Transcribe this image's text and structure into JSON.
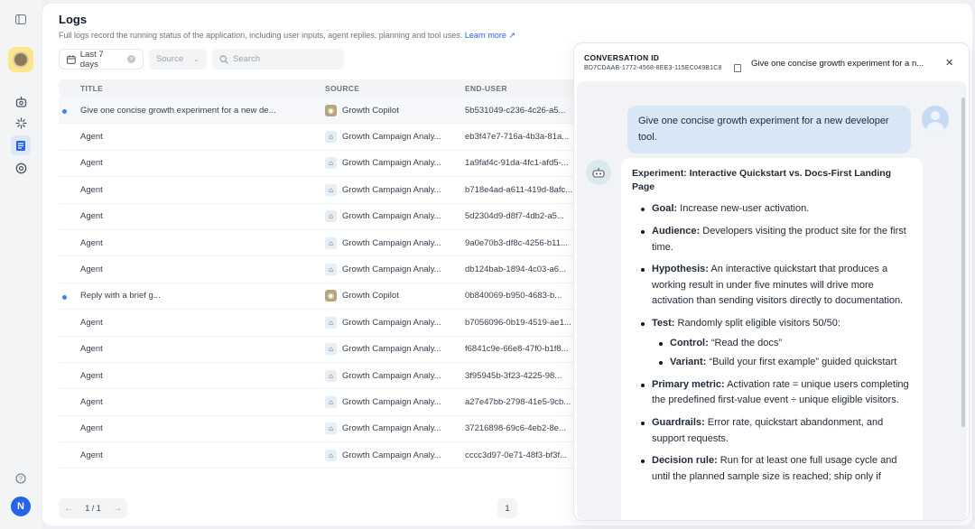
{
  "rail": {
    "icons": [
      "sidebar-toggle-icon",
      "app-avatar",
      "robot-icon",
      "sparkle-icon",
      "logs-icon",
      "gauge-icon",
      "help-icon"
    ],
    "user_initial": "N"
  },
  "page": {
    "title": "Logs",
    "description": "Full logs record the running status of the application, including user inputs, agent replies, planning and tool uses.",
    "learn_more": "Learn more"
  },
  "filters": {
    "date_label": "Last 7 days",
    "source_placeholder": "Source",
    "search_placeholder": "Search"
  },
  "table": {
    "columns": [
      "TITLE",
      "SOURCE",
      "END-USER"
    ],
    "rows": [
      {
        "title": "Give one concise growth experiment for a new de...",
        "source": "Growth Copilot",
        "end_user": "5b531049-c236-4c26-a5...",
        "unread": true,
        "kind": "copilot",
        "selected": true
      },
      {
        "title": "Agent",
        "source": "Growth Campaign Analy...",
        "end_user": "eb3f47e7-716a-4b3a-81a...",
        "unread": false,
        "kind": "bot",
        "selected": false
      },
      {
        "title": "Agent",
        "source": "Growth Campaign Analy...",
        "end_user": "1a9faf4c-91da-4fc1-afd5-...",
        "unread": false,
        "kind": "bot",
        "selected": false
      },
      {
        "title": "Agent",
        "source": "Growth Campaign Analy...",
        "end_user": "b718e4ad-a611-419d-8afc...",
        "unread": false,
        "kind": "bot",
        "selected": false
      },
      {
        "title": "Agent",
        "source": "Growth Campaign Analy...",
        "end_user": "5d2304d9-d8f7-4db2-a5...",
        "unread": false,
        "kind": "bot",
        "selected": false
      },
      {
        "title": "Agent",
        "source": "Growth Campaign Analy...",
        "end_user": "9a0e70b3-df8c-4256-b11...",
        "unread": false,
        "kind": "bot",
        "selected": false
      },
      {
        "title": "Agent",
        "source": "Growth Campaign Analy...",
        "end_user": "db124bab-1894-4c03-a6...",
        "unread": false,
        "kind": "bot",
        "selected": false
      },
      {
        "title": "Reply with a brief g...",
        "source": "Growth Copilot",
        "end_user": "0b840069-b950-4683-b...",
        "unread": true,
        "kind": "copilot",
        "selected": false
      },
      {
        "title": "Agent",
        "source": "Growth Campaign Analy...",
        "end_user": "b7056096-0b19-4519-ae1...",
        "unread": false,
        "kind": "bot",
        "selected": false
      },
      {
        "title": "Agent",
        "source": "Growth Campaign Analy...",
        "end_user": "f6841c9e-66e8-47f0-b1f8...",
        "unread": false,
        "kind": "bot",
        "selected": false
      },
      {
        "title": "Agent",
        "source": "Growth Campaign Analy...",
        "end_user": "3f95945b-3f23-4225-98...",
        "unread": false,
        "kind": "bot",
        "selected": false
      },
      {
        "title": "Agent",
        "source": "Growth Campaign Analy...",
        "end_user": "a27e47bb-2798-41e5-9cb...",
        "unread": false,
        "kind": "bot",
        "selected": false
      },
      {
        "title": "Agent",
        "source": "Growth Campaign Analy...",
        "end_user": "37216898-69c6-4eb2-8e...",
        "unread": false,
        "kind": "bot",
        "selected": false
      },
      {
        "title": "Agent",
        "source": "Growth Campaign Analy...",
        "end_user": "cccc3d97-0e71-48f3-bf3f...",
        "unread": false,
        "kind": "bot",
        "selected": false
      }
    ]
  },
  "pagination": {
    "page_of": "1 / 1",
    "current": "1"
  },
  "drawer": {
    "label": "CONVERSATION ID",
    "conversation_id": "BD7CDAAB-1772-4568-8EE3-115EC049B1C8",
    "title": "Give one concise growth experiment for a n...",
    "user_message": "Give one concise growth experiment for a new developer tool.",
    "reply": {
      "heading": "Experiment: Interactive Quickstart vs. Docs-First Landing Page",
      "goal_label": "Goal:",
      "goal": " Increase new-user activation.",
      "audience_label": "Audience:",
      "audience": " Developers visiting the product site for the first time.",
      "hypothesis_label": "Hypothesis:",
      "hypothesis": " An interactive quickstart that produces a working result in under five minutes will drive more activation than sending visitors directly to documentation.",
      "test_label": "Test:",
      "test": " Randomly split eligible visitors 50/50:",
      "control_label": "Control:",
      "control": " “Read the docs”",
      "variant_label": "Variant:",
      "variant": " “Build your first example” guided quickstart",
      "metric_label": "Primary metric:",
      "metric": " Activation rate = unique users completing the predefined first-value event ÷ unique eligible visitors.",
      "guardrails_label": "Guardrails:",
      "guardrails": " Error rate, quickstart abandonment, and support requests.",
      "decision_label": "Decision rule:",
      "decision": " Run for at least one full usage cycle and until the planned sample size is reached; ship only if"
    }
  }
}
